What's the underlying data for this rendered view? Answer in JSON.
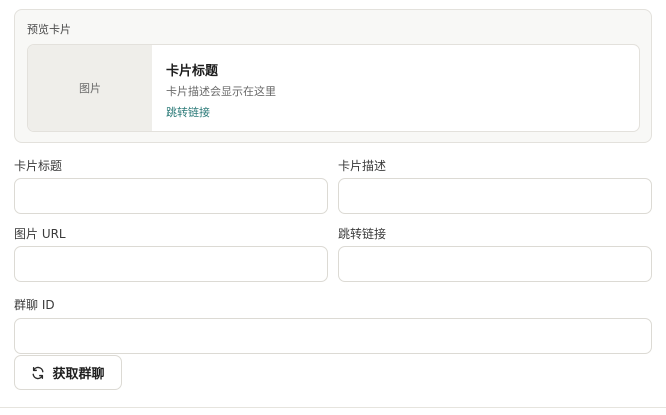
{
  "preview": {
    "label": "预览卡片",
    "card": {
      "image_placeholder": "图片",
      "title": "卡片标题",
      "description": "卡片描述会显示在这里",
      "link_text": "跳转链接"
    }
  },
  "form": {
    "card_title": {
      "label": "卡片标题",
      "value": ""
    },
    "card_description": {
      "label": "卡片描述",
      "value": ""
    },
    "image_url": {
      "label": "图片 URL",
      "value": ""
    },
    "jump_link": {
      "label": "跳转链接",
      "value": ""
    },
    "group_id": {
      "label": "群聊 ID",
      "value": ""
    }
  },
  "actions": {
    "fetch_group_label": "获取群聊",
    "fetch_group_icon": "refresh-icon"
  },
  "colors": {
    "link": "#2b7a78",
    "border": "#dcdad4",
    "preview_bg": "#f8f8f6",
    "image_bg": "#efeeea"
  }
}
